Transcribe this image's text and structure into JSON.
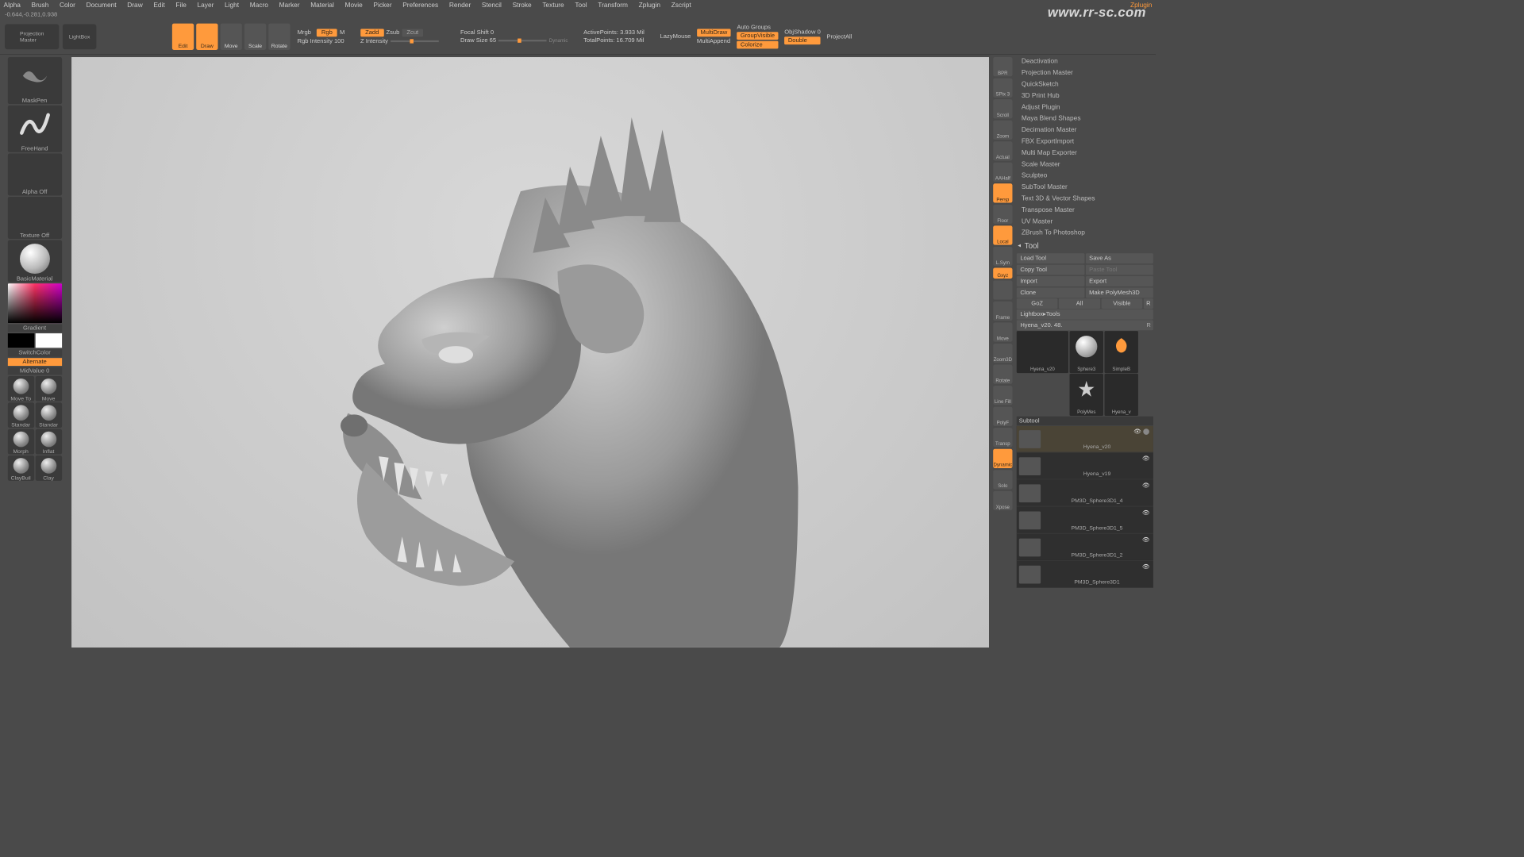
{
  "watermark": "www.rr-sc.com",
  "status": {
    "coords": "-0.644,-0.281,0.938"
  },
  "menu": [
    "Alpha",
    "Brush",
    "Color",
    "Document",
    "Draw",
    "Edit",
    "File",
    "Layer",
    "Light",
    "Macro",
    "Marker",
    "Material",
    "Movie",
    "Picker",
    "Preferences",
    "Render",
    "Stencil",
    "Stroke",
    "Texture",
    "Tool",
    "Transform",
    "Zplugin",
    "Zscript"
  ],
  "menu_right": "Zplugin",
  "toolbar": {
    "projection": "Projection\nMaster",
    "lightbox": "LightBox",
    "modes": [
      {
        "label": "Edit",
        "active": true
      },
      {
        "label": "Draw",
        "active": true
      },
      {
        "label": "Move",
        "active": false
      },
      {
        "label": "Scale",
        "active": false
      },
      {
        "label": "Rotate",
        "active": false
      }
    ],
    "mrgb": "Mrgb",
    "rgb": "Rgb",
    "m": "M",
    "rgb_intensity": "Rgb Intensity 100",
    "zadd": "Zadd",
    "zsub": "Zsub",
    "zcut": "Zcut",
    "z_intensity": "Z Intensity",
    "focal": "Focal Shift 0",
    "drawsize": "Draw Size 65",
    "dynamic": "Dynamic",
    "active_points": "ActivePoints: 3.933 Mil",
    "total_points": "TotalPoints: 16.709 Mil",
    "lazymouse": "LazyMouse",
    "multidraw": "MultiDraw",
    "multiappend": "MultiAppend",
    "autogroups": "Auto Groups",
    "groupvisible": "GroupVisible",
    "colorize": "Colorize",
    "objshadow": "ObjShadow 0",
    "double": "Double",
    "projectall": "ProjectAll"
  },
  "left": {
    "brush": "MaskPen",
    "stroke": "FreeHand",
    "alpha": "Alpha Off",
    "texture": "Texture Off",
    "material": "BasicMaterial",
    "gradient": "Gradient",
    "switchcolor": "SwitchColor",
    "alternate": "Alternate",
    "midvalue": "MidValue 0",
    "brushes": [
      "Move To",
      "Move",
      "Standar",
      "Standar",
      "Morph",
      "Inflat",
      "ClayBuil",
      "Clay"
    ]
  },
  "right_strip": [
    "BPR",
    "SPix 3",
    "Scroll",
    "Zoom",
    "Actual",
    "AAHalf",
    "Persp",
    "Floor",
    "Local",
    "L.Sym",
    "Gxyz",
    "",
    "Frame",
    "Move",
    "Zoom3D",
    "Rotate",
    "Line Fill",
    "PolyF",
    "Transp",
    "Dynamic",
    "Solo",
    "Xpose"
  ],
  "zplugin": {
    "items": [
      "Deactivation",
      "Projection Master",
      "QuickSketch",
      "3D Print Hub",
      "Adjust Plugin",
      "Maya Blend Shapes",
      "Decimation Master",
      "FBX ExportImport",
      "Multi Map Exporter",
      "Scale Master",
      "Sculpteo",
      "SubTool Master",
      "Text 3D & Vector Shapes",
      "Transpose Master",
      "UV Master",
      "ZBrush To Photoshop"
    ]
  },
  "tool": {
    "header": "Tool",
    "load": "Load Tool",
    "save": "Save As",
    "copy": "Copy Tool",
    "paste": "Paste Tool",
    "import": "Import",
    "export": "Export",
    "clone": "Clone",
    "makepoly": "Make PolyMesh3D",
    "goz": "GoZ",
    "all": "All",
    "visible": "Visible",
    "r": "R",
    "lightbox": "Lightbox▸Tools",
    "current": "Hyena_v20. 48.",
    "thumbs": [
      "Hyena_v20",
      "Sphere3",
      "SimpleB",
      "PolyMes",
      "Hyena_v"
    ]
  },
  "subtool": {
    "header": "Subtool",
    "items": [
      {
        "name": "Hyena_v20",
        "active": true
      },
      {
        "name": "Hyena_v19",
        "active": false
      },
      {
        "name": "PM3D_Sphere3D1_4",
        "active": false
      },
      {
        "name": "PM3D_Sphere3D1_5",
        "active": false
      },
      {
        "name": "PM3D_Sphere3D1_2",
        "active": false
      },
      {
        "name": "PM3D_Sphere3D1",
        "active": false
      }
    ]
  }
}
